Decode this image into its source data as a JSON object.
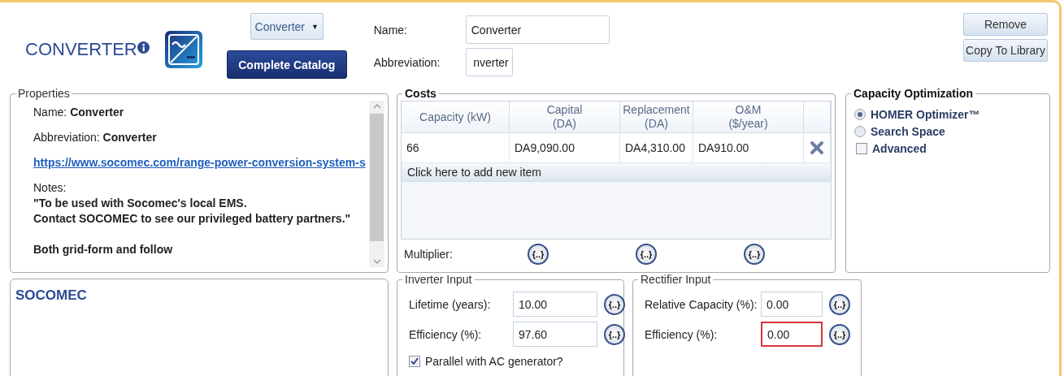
{
  "header": {
    "title": "CONVERTER",
    "type_dropdown": {
      "value": "Converter",
      "caret": "▼"
    },
    "catalog_button": "Complete Catalog",
    "fields": [
      {
        "label": "Name:",
        "value": "Converter"
      },
      {
        "label": "Abbreviation:",
        "value": "nverter"
      }
    ],
    "buttons": [
      "Remove",
      "Copy To Library"
    ]
  },
  "properties": {
    "title": "Properties",
    "lines": [
      {
        "kind": "pair",
        "label": "Name: ",
        "value": "Converter"
      },
      {
        "kind": "pair",
        "label": "Abbreviation: ",
        "value": "Converter"
      },
      {
        "kind": "link",
        "text": "https://www.socomec.com/range-power-conversion-system-s"
      },
      {
        "kind": "label",
        "text": "Notes:"
      },
      {
        "kind": "bold",
        "text": "\"To be used with Socomec's local EMS."
      },
      {
        "kind": "bold",
        "text": "Contact SOCOMEC to see our privileged battery partners.\""
      },
      {
        "kind": "gap"
      },
      {
        "kind": "bold",
        "text": "Both grid-form and follow"
      }
    ]
  },
  "manufacturer": "SOCOMEC",
  "costs": {
    "title": "Costs",
    "columns": [
      "Capacity (kW)",
      "Capital\n(DA)",
      "Replacement\n(DA)",
      "O&M\n($/year)"
    ],
    "rows": [
      [
        "66",
        "DA9,090.00",
        "DA4,310.00",
        "DA910.00"
      ]
    ],
    "add_row": "Click here to add new item",
    "multiplier_label": "Multiplier:",
    "multiplier_buttons": [
      "{..}",
      "{..}",
      "{..}"
    ]
  },
  "capacity_optimization": {
    "title": "Capacity Optimization",
    "options": [
      {
        "label": "HOMER Optimizer™",
        "selected": true
      },
      {
        "label": "Search Space",
        "selected": false
      }
    ],
    "advanced": {
      "label": "Advanced",
      "checked": false
    }
  },
  "inverter_input": {
    "title": "Inverter Input",
    "fields": [
      {
        "label": "Lifetime (years):",
        "value": "10.00",
        "error": false,
        "button": "{..}"
      },
      {
        "label": "Efficiency (%):",
        "value": "97.60",
        "error": false,
        "button": "{..}"
      }
    ],
    "parallel": {
      "label": "Parallel with AC generator?",
      "checked": true
    }
  },
  "rectifier_input": {
    "title": "Rectifier Input",
    "fields": [
      {
        "label": "Relative Capacity (%):",
        "value": "0.00",
        "error": false,
        "button": "{..}"
      },
      {
        "label": "Efficiency (%):",
        "value": "0.00",
        "error": true,
        "button": "{..}"
      }
    ]
  }
}
